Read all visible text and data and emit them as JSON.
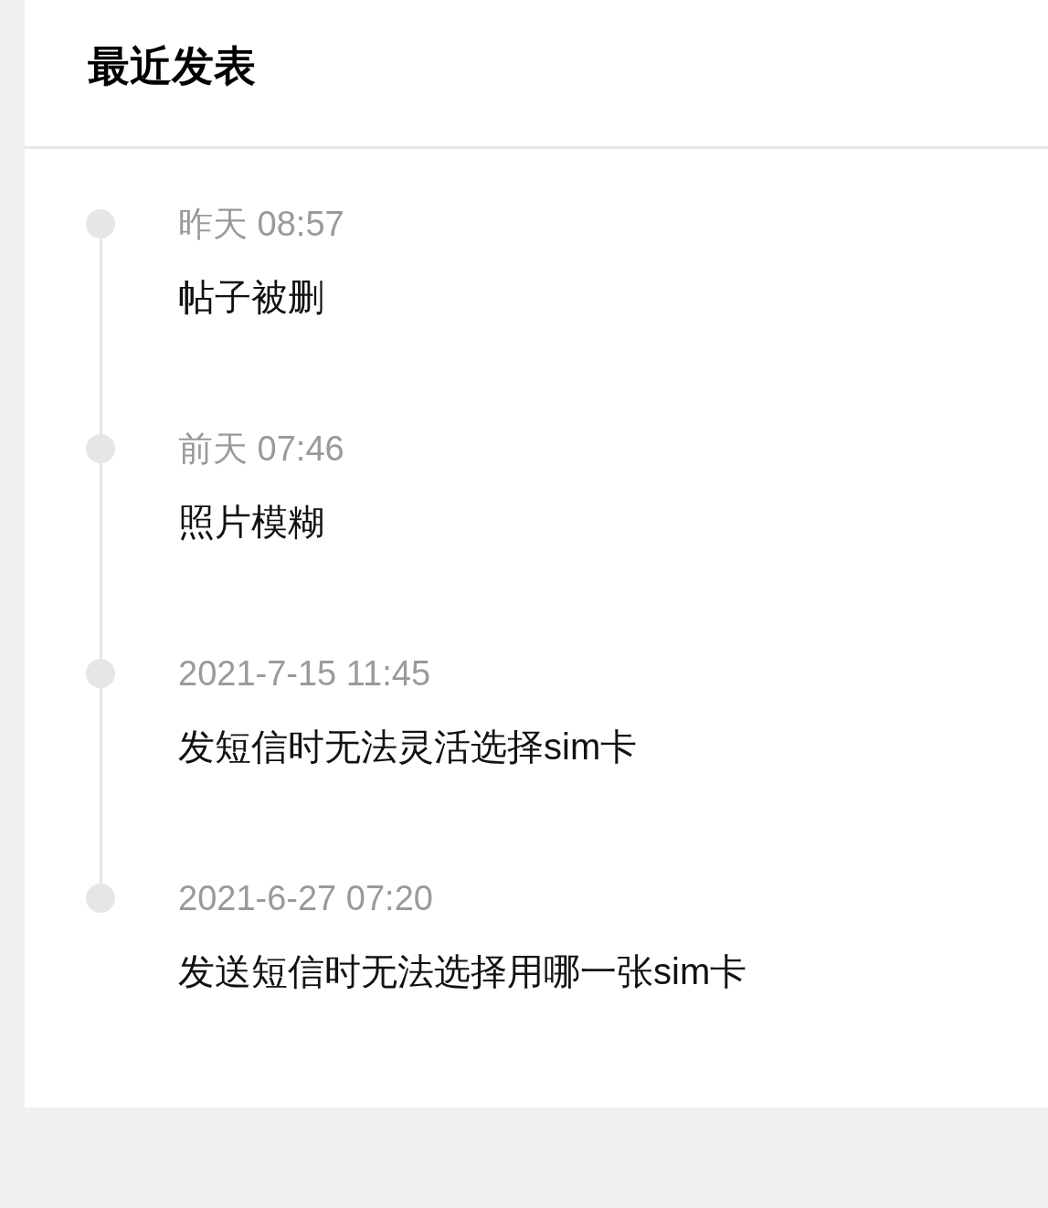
{
  "title": "最近发表",
  "posts": [
    {
      "time": "昨天 08:57",
      "title": "帖子被删"
    },
    {
      "time": "前天 07:46",
      "title": "照片模糊"
    },
    {
      "time": "2021-7-15 11:45",
      "title": "发短信时无法灵活选择sim卡"
    },
    {
      "time": "2021-6-27 07:20",
      "title": "发送短信时无法选择用哪一张sim卡"
    }
  ]
}
